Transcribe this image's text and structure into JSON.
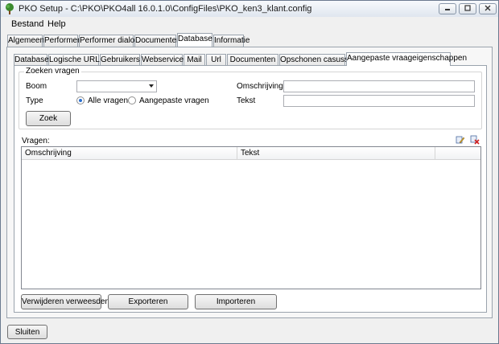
{
  "window": {
    "title": "PKO Setup - C:\\PKO\\PKO4all 16.0.1.0\\ConfigFiles\\PKO_ken3_klant.config",
    "icon": "tree-icon",
    "controls": [
      "minimize",
      "maximize",
      "close"
    ]
  },
  "menu": {
    "items": [
      {
        "label": "Bestand"
      },
      {
        "label": "Help"
      }
    ]
  },
  "main_tabs": [
    {
      "label": "Algemeen"
    },
    {
      "label": "Performer"
    },
    {
      "label": "Performer dialoog"
    },
    {
      "label": "Documenten"
    },
    {
      "label": "Database",
      "active": true
    },
    {
      "label": "Informatie"
    }
  ],
  "sub_tabs": [
    {
      "label": "Database"
    },
    {
      "label": "Logische URLs"
    },
    {
      "label": "Gebruikers"
    },
    {
      "label": "Webservice"
    },
    {
      "label": "Mail"
    },
    {
      "label": "Url"
    },
    {
      "label": "Documenten"
    },
    {
      "label": "Opschonen casussen"
    },
    {
      "label": "Aangepaste vraageigenschappen",
      "active": true
    }
  ],
  "search": {
    "group_title": "Zoeken vragen",
    "boom_label": "Boom",
    "boom_value": "",
    "type_label": "Type",
    "radio_all": "Alle vragen",
    "radio_custom": "Aangepaste vragen",
    "selected": "Alle vragen",
    "omschrijving_label": "Omschrijving",
    "omschrijving_value": "",
    "tekst_label": "Tekst",
    "tekst_value": "",
    "search_button": "Zoek"
  },
  "questions": {
    "label": "Vragen:",
    "columns": [
      "Omschrijving",
      "Tekst"
    ],
    "rows": [],
    "toolbar_icons": [
      "edit-icon",
      "delete-icon"
    ]
  },
  "actions": {
    "remove_refs": "Verwijderen verweesden",
    "export": "Exporteren",
    "import": "Importeren"
  },
  "footer": {
    "close_button": "Sluiten"
  },
  "colors": {
    "accent": "#2a6fd0",
    "delete": "#d02020"
  }
}
